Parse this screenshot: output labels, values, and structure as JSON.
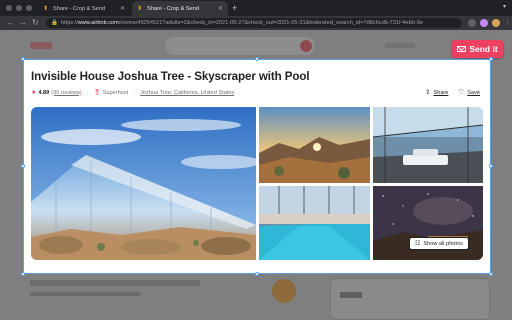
{
  "browser": {
    "tabs": [
      {
        "title": "Share - Crop & Send",
        "active": false
      },
      {
        "title": "Share - Crop & Send",
        "active": true
      }
    ],
    "new_tab_icon": "plus-icon",
    "url_prefix": "https://",
    "url_host": "www.airbnb.com",
    "url_path": "/rooms/45054521?adults=2&check_in=2021-05-27&check_out=2021-05-31&federated_search_id=7d8c6cdb-731f-4ebb-9e"
  },
  "extension": {
    "send_label": "Send it",
    "accent": "#ee4161",
    "selection_color": "#5aa0e6"
  },
  "listing": {
    "title": "Invisible House Joshua Tree - Skyscraper with Pool",
    "rating": "4.89",
    "reviews": "(35 reviews)",
    "host_status": "Superhost",
    "location": "Joshua Tree, California, United States",
    "share_label": "Share",
    "save_label": "Save",
    "show_all_label": "Show all photos"
  },
  "colors": {
    "brand": "#ff385c",
    "text": "#222222",
    "muted": "#717171"
  }
}
